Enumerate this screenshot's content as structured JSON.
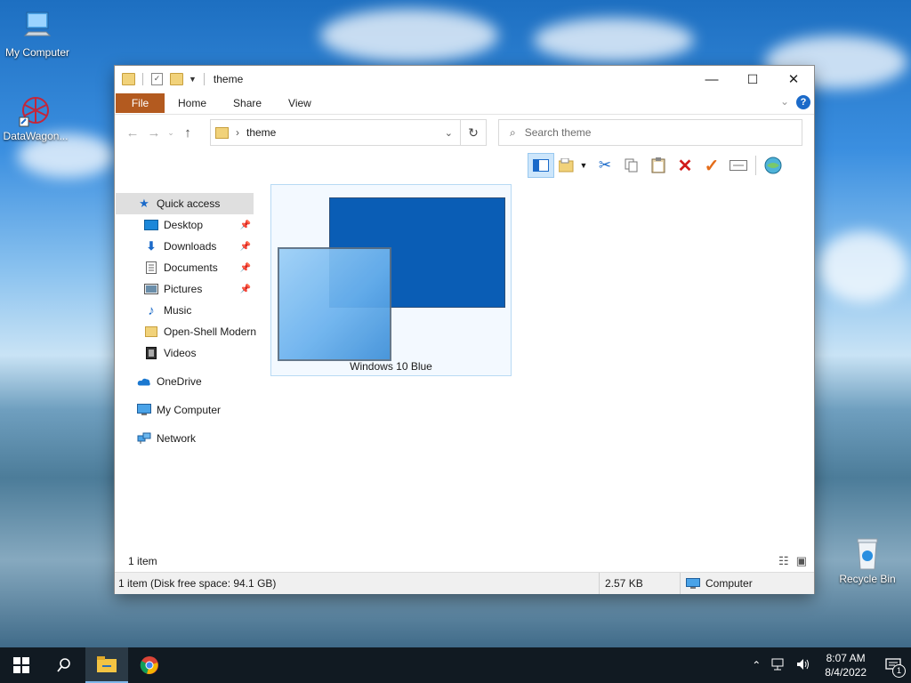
{
  "desktop": {
    "icons": [
      {
        "label": "My Computer",
        "icon": "computer-icon"
      },
      {
        "label": "DataWagon...",
        "icon": "app-shortcut-icon"
      },
      {
        "label": "Recycle Bin",
        "icon": "recycle-bin-icon"
      }
    ]
  },
  "window": {
    "title": "theme",
    "controls": {
      "minimize": "—",
      "maximize": "☐",
      "close": "✕"
    },
    "ribbon": {
      "file": "File",
      "tabs": [
        "Home",
        "Share",
        "View"
      ],
      "help": "?"
    },
    "address": {
      "path_sep": "›",
      "folder": "theme",
      "search_placeholder": "Search theme"
    },
    "nav": {
      "items": [
        {
          "label": "Quick access",
          "icon": "star-icon",
          "pinned": false,
          "selected": true
        },
        {
          "label": "Desktop",
          "icon": "desktop-icon",
          "pinned": true
        },
        {
          "label": "Downloads",
          "icon": "download-icon",
          "pinned": true
        },
        {
          "label": "Documents",
          "icon": "document-icon",
          "pinned": true
        },
        {
          "label": "Pictures",
          "icon": "pictures-icon",
          "pinned": true
        },
        {
          "label": "Music",
          "icon": "music-icon",
          "pinned": false
        },
        {
          "label": "Open-Shell Modern",
          "icon": "folder-icon",
          "pinned": false
        },
        {
          "label": "Videos",
          "icon": "video-icon",
          "pinned": false
        },
        {
          "label": "OneDrive",
          "icon": "cloud-icon",
          "pinned": false
        },
        {
          "label": "My Computer",
          "icon": "computer-icon",
          "pinned": false
        },
        {
          "label": "Network",
          "icon": "network-icon",
          "pinned": false
        }
      ]
    },
    "content": {
      "items": [
        {
          "name": "Windows 10 Blue"
        }
      ]
    },
    "status": {
      "count": "1 item",
      "disk": "1 item (Disk free space: 94.1 GB)",
      "size": "2.57 KB",
      "location": "Computer"
    }
  },
  "taskbar": {
    "time": "8:07 AM",
    "date": "8/4/2022",
    "notifications": "1"
  },
  "colors": {
    "file_tab": "#b35a1f",
    "accent": "#1b6ac9",
    "tile_dark": "#0a5db5",
    "tile_light": "#6bb2ee"
  }
}
